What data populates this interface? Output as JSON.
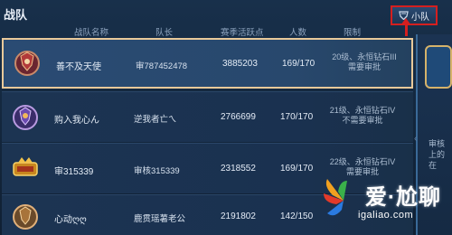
{
  "header": {
    "title": "战队",
    "tab_label": "小队"
  },
  "columns": [
    "战队名称",
    "队长",
    "赛季活跃点",
    "人数",
    "限制"
  ],
  "rows": [
    {
      "name": "善不及天使",
      "captain": "审787452478",
      "points": "3885203",
      "members": "169/170",
      "limit": [
        "20级、永恒钻石III",
        "需要审批"
      ],
      "selected": true
    },
    {
      "name": "购入我心ん",
      "captain": "逆我者亡ㄟ",
      "points": "2766699",
      "members": "170/170",
      "limit": [
        "21级、永恒钻石IV",
        "不需要审批"
      ],
      "selected": false
    },
    {
      "name": "审315339",
      "captain": "审核315339",
      "points": "2318552",
      "members": "169/170",
      "limit": [
        "22级、永恒钻石IV",
        "需要审批"
      ],
      "selected": false
    },
    {
      "name": "心动ღღ",
      "captain": "鹿贯瑶薯老公",
      "points": "2191802",
      "members": "142/150",
      "limit": [
        "",
        ""
      ],
      "selected": false
    }
  ],
  "right_panel": {
    "lines": [
      "审核",
      "上的",
      "在"
    ]
  },
  "watermark": {
    "main": "爱·尬聊",
    "url": "igaliao.com"
  },
  "colors": {
    "highlight_border": "#d51f1f",
    "selected_border": "#e8c99a",
    "bg": "#14263d"
  }
}
